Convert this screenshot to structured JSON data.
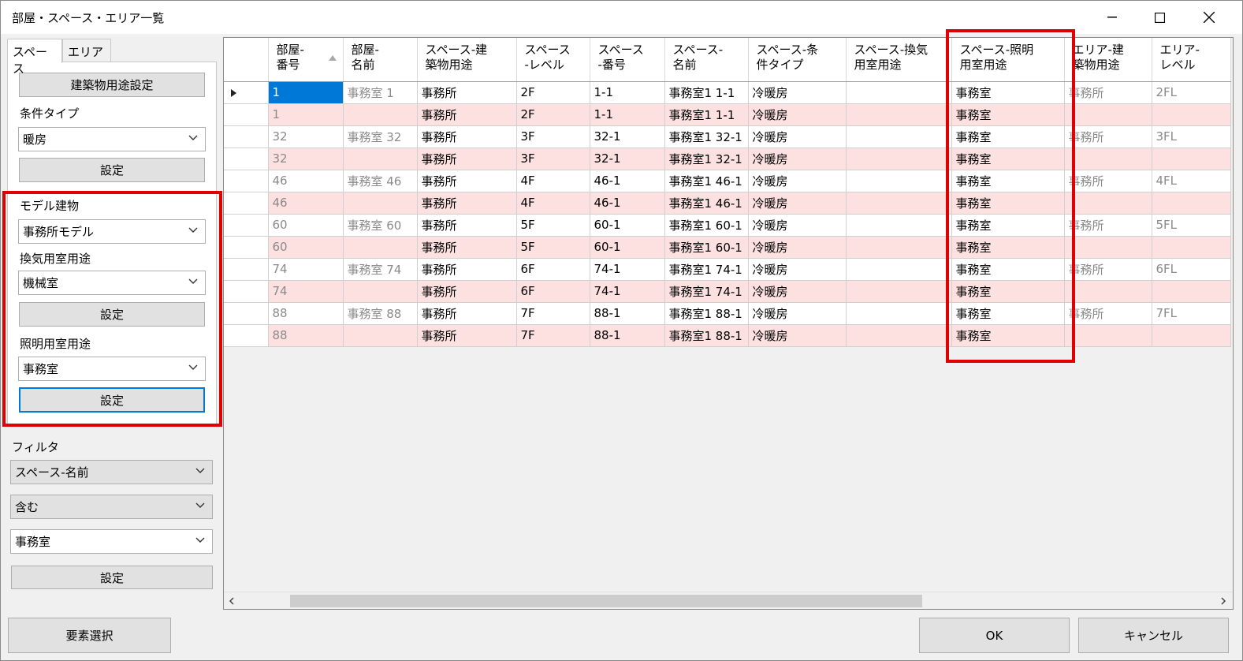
{
  "window": {
    "title": "部屋・スペース・エリア一覧",
    "minimize_icon": "minimize-icon",
    "maximize_icon": "maximize-icon",
    "close_icon": "close-icon"
  },
  "tabs": [
    "スペース",
    "エリア"
  ],
  "left": {
    "building_use_button": "建築物用途設定",
    "condition_type_label": "条件タイプ",
    "condition_type_value": "暖房",
    "set_button": "設定",
    "model_building_label": "モデル建物",
    "model_building_value": "事務所モデル",
    "ventilation_label": "換気用室用途",
    "ventilation_value": "機械室",
    "lighting_label": "照明用室用途",
    "lighting_value": "事務室"
  },
  "filter": {
    "label": "フィルタ",
    "field_value": "スペース-名前",
    "op_value": "含む",
    "text_value": "事務室",
    "set_button": "設定"
  },
  "element_select_button": "要素選択",
  "ok_button": "OK",
  "cancel_button": "キャンセル",
  "grid": {
    "columns": [
      "部屋-\n番号",
      "部屋-\n名前",
      "スペース-建\n築物用途",
      "スペース\n-レベル",
      "スペース\n-番号",
      "スペース-\n名前",
      "スペース-条\n件タイプ",
      "スペース-換気\n用室用途",
      "スペース-照明\n用室用途",
      "エリア-建\n築物用途",
      "エリア-\nレベル"
    ],
    "rows": [
      [
        "1",
        "事務室 1",
        "事務所",
        "2F",
        "1-1",
        "事務室1 1-1",
        "冷暖房",
        "",
        "事務室",
        "事務所",
        "2FL"
      ],
      [
        "1",
        "",
        "事務所",
        "2F",
        "1-1",
        "事務室1 1-1",
        "冷暖房",
        "",
        "事務室",
        "",
        ""
      ],
      [
        "32",
        "事務室 32",
        "事務所",
        "3F",
        "32-1",
        "事務室1 32-1",
        "冷暖房",
        "",
        "事務室",
        "事務所",
        "3FL"
      ],
      [
        "32",
        "",
        "事務所",
        "3F",
        "32-1",
        "事務室1 32-1",
        "冷暖房",
        "",
        "事務室",
        "",
        ""
      ],
      [
        "46",
        "事務室 46",
        "事務所",
        "4F",
        "46-1",
        "事務室1 46-1",
        "冷暖房",
        "",
        "事務室",
        "事務所",
        "4FL"
      ],
      [
        "46",
        "",
        "事務所",
        "4F",
        "46-1",
        "事務室1 46-1",
        "冷暖房",
        "",
        "事務室",
        "",
        ""
      ],
      [
        "60",
        "事務室 60",
        "事務所",
        "5F",
        "60-1",
        "事務室1 60-1",
        "冷暖房",
        "",
        "事務室",
        "事務所",
        "5FL"
      ],
      [
        "60",
        "",
        "事務所",
        "5F",
        "60-1",
        "事務室1 60-1",
        "冷暖房",
        "",
        "事務室",
        "",
        ""
      ],
      [
        "74",
        "事務室 74",
        "事務所",
        "6F",
        "74-1",
        "事務室1 74-1",
        "冷暖房",
        "",
        "事務室",
        "事務所",
        "6FL"
      ],
      [
        "74",
        "",
        "事務所",
        "6F",
        "74-1",
        "事務室1 74-1",
        "冷暖房",
        "",
        "事務室",
        "",
        ""
      ],
      [
        "88",
        "事務室 88",
        "事務所",
        "7F",
        "88-1",
        "事務室1 88-1",
        "冷暖房",
        "",
        "事務室",
        "事務所",
        "7FL"
      ],
      [
        "88",
        "",
        "事務所",
        "7F",
        "88-1",
        "事務室1 88-1",
        "冷暖房",
        "",
        "事務室",
        "",
        ""
      ]
    ]
  },
  "colors": {
    "highlight_red": "#e00000",
    "odd_row": "#fde1e1",
    "selection_blue": "#0078d7"
  }
}
